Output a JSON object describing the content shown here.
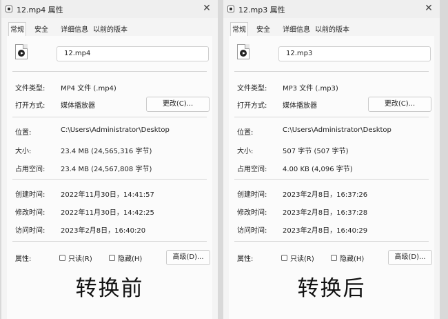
{
  "windows": [
    {
      "title": "12.mp4 属性",
      "tabs": [
        "常规",
        "安全",
        "详细信息",
        "以前的版本"
      ],
      "filename": "12.mp4",
      "file_type_label": "文件类型:",
      "file_type": "MP4 文件 (.mp4)",
      "open_with_label": "打开方式:",
      "open_with": "媒体播放器",
      "change_button": "更改(C)...",
      "location_label": "位置:",
      "location": "C:\\Users\\Administrator\\Desktop",
      "size_label": "大小:",
      "size": "23.4 MB (24,565,316 字节)",
      "disk_size_label": "占用空间:",
      "disk_size": "23.4 MB (24,567,808 字节)",
      "created_label": "创建时间:",
      "created": "2022年11月30日，14:41:57",
      "modified_label": "修改时间:",
      "modified": "2022年11月30日，14:42:25",
      "accessed_label": "访问时间:",
      "accessed": "2023年2月8日，16:40:20",
      "attributes_label": "属性:",
      "readonly": "只读(R)",
      "hidden": "隐藏(H)",
      "advanced_button": "高级(D)...",
      "caption": "转换前"
    },
    {
      "title": "12.mp3 属性",
      "tabs": [
        "常规",
        "安全",
        "详细信息",
        "以前的版本"
      ],
      "filename": "12.mp3",
      "file_type_label": "文件类型:",
      "file_type": "MP3 文件 (.mp3)",
      "open_with_label": "打开方式:",
      "open_with": "媒体播放器",
      "change_button": "更改(C)...",
      "location_label": "位置:",
      "location": "C:\\Users\\Administrator\\Desktop",
      "size_label": "大小:",
      "size": "507 字节 (507 字节)",
      "disk_size_label": "占用空间:",
      "disk_size": "4.00 KB (4,096 字节)",
      "created_label": "创建时间:",
      "created": "2023年2月8日，16:37:26",
      "modified_label": "修改时间:",
      "modified": "2023年2月8日，16:37:28",
      "accessed_label": "访问时间:",
      "accessed": "2023年2月8日，16:40:29",
      "attributes_label": "属性:",
      "readonly": "只读(R)",
      "hidden": "隐藏(H)",
      "advanced_button": "高级(D)...",
      "caption": "转换后"
    }
  ]
}
